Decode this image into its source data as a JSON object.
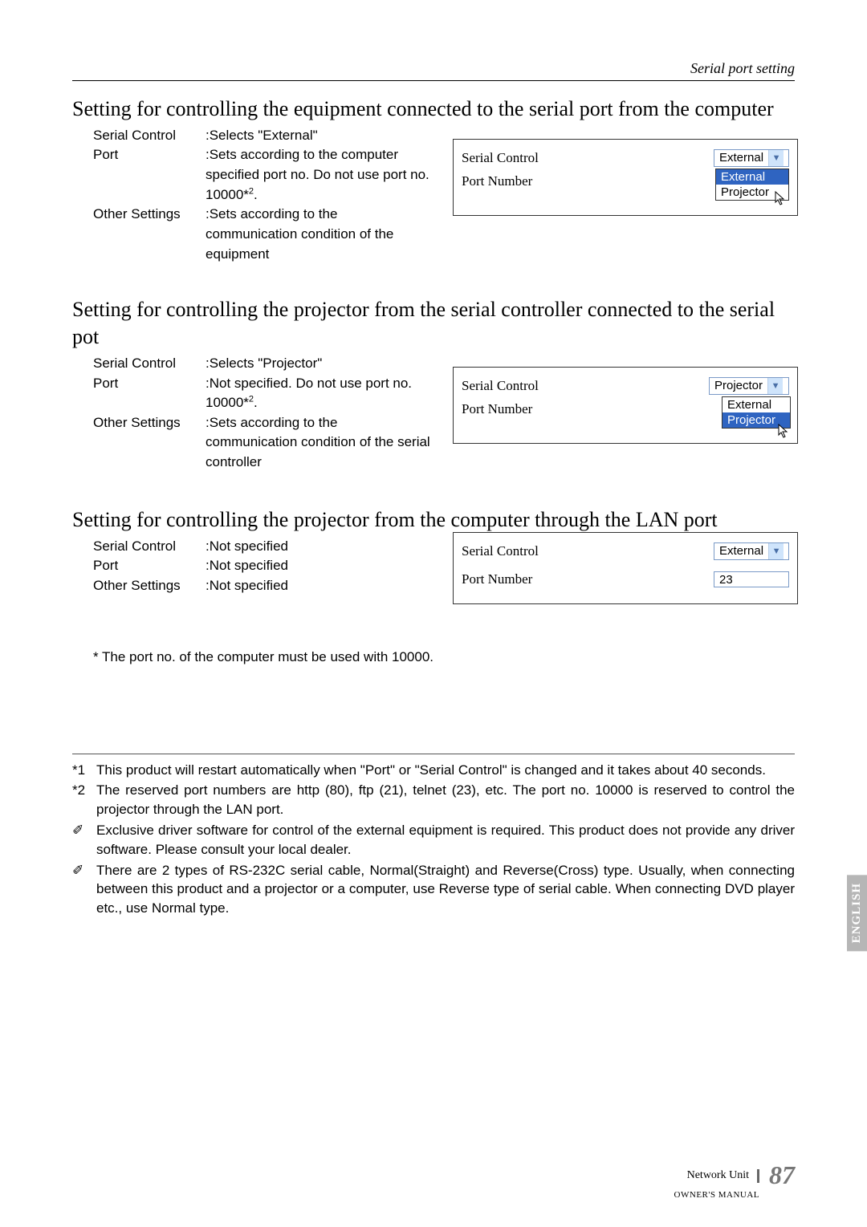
{
  "header": {
    "section": "Serial port setting"
  },
  "s1": {
    "title": "Setting for controlling the equipment connected to the serial port from the computer",
    "r1_term": "Serial Control",
    "r1_desc": ":Selects \"External\"",
    "r2_term": "Port",
    "r2_desc_a": ":Sets according to the computer specified port no. Do not use port no. 10000*",
    "r2_desc_sup": "2",
    "r2_desc_b": ".",
    "r3_term": "Other Settings",
    "r3_desc": ":Sets according to the communication condition of the equipment",
    "shot": {
      "row1_label": "Serial Control",
      "row1_value": "External",
      "row2_label": "Port Number",
      "open_opt1": "External",
      "open_opt2": "Projector"
    }
  },
  "s2": {
    "title": "Setting for controlling the projector from the serial controller connected to the serial pot",
    "r1_term": "Serial Control",
    "r1_desc": ":Selects \"Projector\"",
    "r2_term": "Port",
    "r2_desc_a": ":Not specified. Do not use port no. 10000*",
    "r2_desc_sup": "2",
    "r2_desc_b": ".",
    "r3_term": "Other Settings",
    "r3_desc": ":Sets according to the communication condition of the serial controller",
    "shot": {
      "row1_label": "Serial Control",
      "row1_value": "Projector",
      "row2_label": "Port Number",
      "open_opt1": "External",
      "open_opt2": "Projector"
    }
  },
  "s3": {
    "title": "Setting for controlling the projector from the computer through the LAN port",
    "r1_term": "Serial Control",
    "r1_desc": ":Not specified",
    "r2_term": "Port",
    "r2_desc": ":Not specified",
    "r3_term": "Other Settings",
    "r3_desc": ":Not specified",
    "shot": {
      "row1_label": "Serial Control",
      "row1_value": "External",
      "row2_label": "Port Number",
      "row2_value": "23"
    }
  },
  "note": "* The port no. of the computer must be used with 10000.",
  "footnotes": {
    "f1_marker": "*1",
    "f1_body": "This product will restart automatically when \"Port\" or \"Serial Control\" is changed and it takes about 40 seconds.",
    "f2_marker": "*2",
    "f2_body": "The reserved port numbers are http (80), ftp (21), telnet (23), etc. The port no. 10000 is reserved to control the projector through the LAN port.",
    "f3_marker": "✐",
    "f3_body": "Exclusive driver software for control of the external equipment is required. This product does not provide any driver software. Please consult your local dealer.",
    "f4_marker": "✐",
    "f4_body": "There are 2 types of RS-232C serial cable, Normal(Straight) and Reverse(Cross) type. Usually, when connecting between this product and a projector or a computer, use Reverse type of serial cable. When connecting DVD player etc., use Normal type."
  },
  "side_tab": "ENGLISH",
  "footer": {
    "line1": "Network Unit",
    "page": "87",
    "line2": "OWNER'S MANUAL"
  }
}
